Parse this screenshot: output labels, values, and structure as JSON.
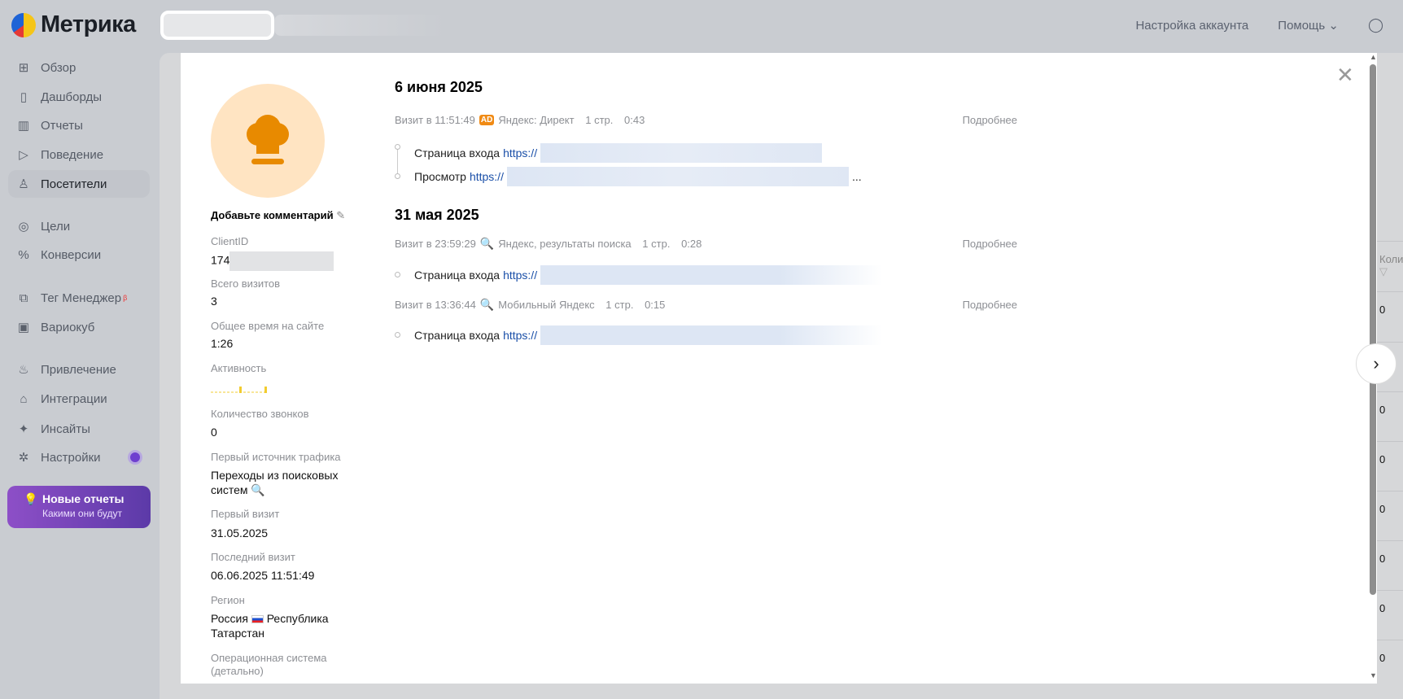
{
  "header": {
    "logo": "Метрика",
    "account_settings": "Настройка аккаунта",
    "help": "Помощь"
  },
  "sidebar": {
    "items": [
      {
        "label": "Обзор",
        "icon": "grid-icon"
      },
      {
        "label": "Дашборды",
        "icon": "dashboard-icon"
      },
      {
        "label": "Отчеты",
        "icon": "bar-chart-icon"
      },
      {
        "label": "Поведение",
        "icon": "play-icon"
      },
      {
        "label": "Посетители",
        "icon": "user-icon"
      },
      {
        "label": "Цели",
        "icon": "target-icon"
      },
      {
        "label": "Конверсии",
        "icon": "percent-icon"
      },
      {
        "label": "Тег Менеджер",
        "icon": "tag-icon",
        "badge": "β"
      },
      {
        "label": "Вариокуб",
        "icon": "cube-icon"
      },
      {
        "label": "Привлечение",
        "icon": "fire-icon"
      },
      {
        "label": "Интеграции",
        "icon": "puzzle-icon"
      },
      {
        "label": "Инсайты",
        "icon": "sparkle-icon"
      },
      {
        "label": "Настройки",
        "icon": "gear-icon"
      }
    ],
    "promo": {
      "title": "Новые отчеты",
      "subtitle": "Какими они будут"
    }
  },
  "background_table": {
    "header": "Коли",
    "values": [
      "0",
      "0",
      "0",
      "0",
      "0",
      "0",
      "0",
      "0"
    ]
  },
  "profile": {
    "comment": "Добавьте комментарий",
    "fields": [
      {
        "label": "ClientID",
        "value": "174"
      },
      {
        "label": "Всего визитов",
        "value": "3"
      },
      {
        "label": "Общее время на сайте",
        "value": "1:26"
      },
      {
        "label": "Активность",
        "value": ""
      },
      {
        "label": "Количество звонков",
        "value": "0"
      },
      {
        "label": "Первый источник трафика",
        "value": "Переходы из поисковых систем"
      },
      {
        "label": "Первый визит",
        "value": "31.05.2025"
      },
      {
        "label": "Последний визит",
        "value": "06.06.2025 11:51:49"
      },
      {
        "label": "Регион",
        "value": "Россия",
        "value2": "Республика Татарстан"
      },
      {
        "label": "Операционная система (детально)",
        "value": ""
      }
    ]
  },
  "history": {
    "more": "Подробнее",
    "entry_page": "Страница входа",
    "view": "Просмотр",
    "url_prefix": "https://",
    "ellipsis": "...",
    "days": [
      {
        "date": "6 июня 2025",
        "visits": [
          {
            "time": "Визит в 11:51:49",
            "source": "Яндекс: Директ",
            "pages": "1 стр.",
            "duration": "0:43",
            "badge": "AD"
          }
        ]
      },
      {
        "date": "31 мая 2025",
        "visits": [
          {
            "time": "Визит в 23:59:29",
            "source": "Яндекс, результаты поиска",
            "pages": "1 стр.",
            "duration": "0:28"
          },
          {
            "time": "Визит в 13:36:44",
            "source": "Мобильный Яндекс",
            "pages": "1 стр.",
            "duration": "0:15"
          }
        ]
      }
    ]
  }
}
